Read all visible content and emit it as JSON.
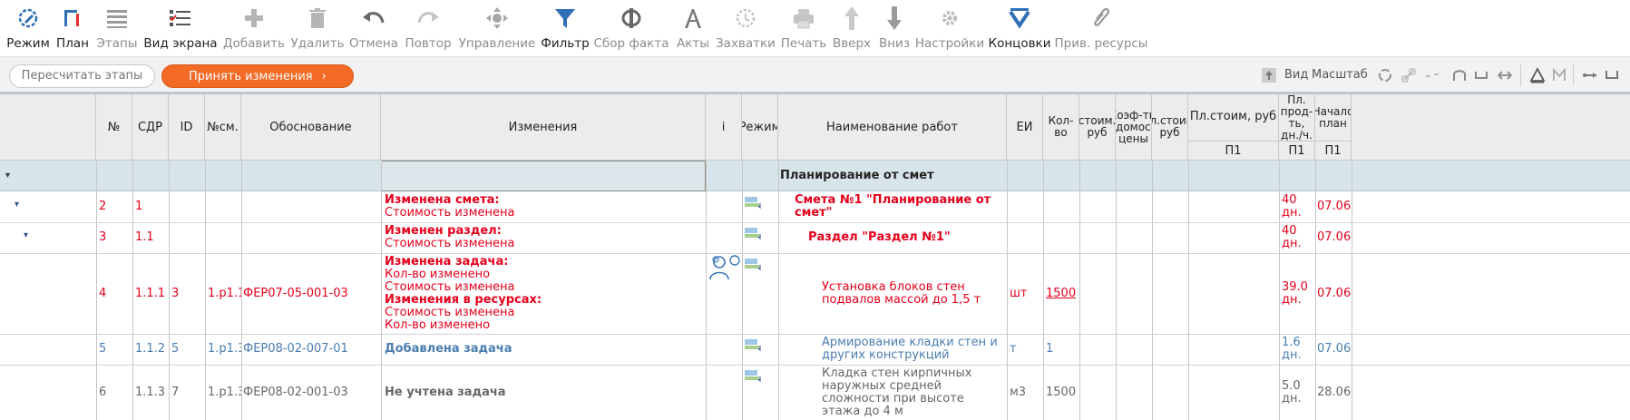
{
  "toolbar": {
    "items": [
      {
        "label": "Режим",
        "icon": "mode-icon",
        "enabled": true
      },
      {
        "label": "План",
        "icon": "plan-icon",
        "enabled": true
      },
      {
        "label": "Этапы",
        "icon": "stages-icon",
        "enabled": false
      },
      {
        "label": "Вид экрана",
        "icon": "screen-view-icon",
        "enabled": true
      },
      {
        "label": "Добавить",
        "icon": "add-icon",
        "enabled": false
      },
      {
        "label": "Удалить",
        "icon": "delete-icon",
        "enabled": false
      },
      {
        "label": "Отмена",
        "icon": "undo-icon",
        "enabled": false
      },
      {
        "label": "Повтор",
        "icon": "redo-icon",
        "enabled": false
      },
      {
        "label": "Управление",
        "icon": "control-icon",
        "enabled": false
      },
      {
        "label": "Фильтр",
        "icon": "filter-icon",
        "enabled": true
      },
      {
        "label": "Сбор факта",
        "icon": "fact-icon",
        "enabled": false
      },
      {
        "label": "Акты",
        "icon": "acts-icon",
        "enabled": false
      },
      {
        "label": "Захватки",
        "icon": "grips-icon",
        "enabled": false
      },
      {
        "label": "Печать",
        "icon": "print-icon",
        "enabled": false
      },
      {
        "label": "Вверх",
        "icon": "arrow-up-icon",
        "enabled": false
      },
      {
        "label": "Вниз",
        "icon": "arrow-down-icon",
        "enabled": false
      },
      {
        "label": "Настройки",
        "icon": "settings-icon",
        "enabled": false
      },
      {
        "label": "Концовки",
        "icon": "endings-icon",
        "enabled": true
      },
      {
        "label": "Прив. ресурсы",
        "icon": "attach-resources-icon",
        "enabled": false
      }
    ]
  },
  "actions": {
    "recalc_label": "Пересчитать этапы",
    "accept_label": "Принять изменения",
    "view_label": "Вид",
    "scale_label": "Масштаб"
  },
  "columns": {
    "num": "№",
    "sdr": "СДР",
    "id": "ID",
    "nsm": "№см.",
    "basis": "Обоснование",
    "changes": "Изменения",
    "info": "i",
    "mode": "Режим",
    "work_name": "Наименование работ",
    "unit": "ЕИ",
    "qty": "Кол-во",
    "unit_cost": "Пл.стоим.ЕИ, руб",
    "coef": "Коэф-ты ведомости цены",
    "cost_cut": "Пл.стоим. руб",
    "plan_cost": "Пл.стоим, руб",
    "plan_cost_sub": "П1",
    "duration": "Пл. прод-ть, дн./ч.",
    "duration_sub": "П1",
    "start": "Начало план",
    "start_sub": "П1"
  },
  "group": {
    "title": "Планирование от смет"
  },
  "rows": [
    {
      "num": "2",
      "sdr": "1",
      "id": "",
      "nsm": "",
      "basis": "",
      "change_title": "Изменена смета:",
      "change_lines": [
        "Стоимость изменена"
      ],
      "change_title2": "",
      "change_lines2": [],
      "work": "Смета №1 \"Планирование от смет\"",
      "unit": "",
      "qty": "",
      "duration": "40 дн.",
      "start": "07.06",
      "style": "red"
    },
    {
      "num": "3",
      "sdr": "1.1",
      "id": "",
      "nsm": "",
      "basis": "",
      "change_title": "Изменен раздел:",
      "change_lines": [
        "Стоимость изменена"
      ],
      "change_title2": "",
      "change_lines2": [],
      "work": "Раздел \"Раздел №1\"",
      "unit": "",
      "qty": "",
      "duration": "40 дн.",
      "start": "07.06",
      "style": "red"
    },
    {
      "num": "4",
      "sdr": "1.1.1",
      "id": "3",
      "nsm": "1.р1.1",
      "basis": "ФЕР07-05-001-03",
      "change_title": "Изменена задача:",
      "change_lines": [
        "Кол-во изменено",
        "Стоимость изменена"
      ],
      "change_title2": "Изменения в ресурсах:",
      "change_lines2": [
        "Стоимость изменена",
        "Кол-во изменено"
      ],
      "work": "Установка блоков стен подвалов массой до 1,5 т",
      "unit": "шт",
      "qty": "1500",
      "duration": "39.0 дн.",
      "start": "07.06",
      "style": "red"
    },
    {
      "num": "5",
      "sdr": "1.1.2",
      "id": "5",
      "nsm": "1.р1.3",
      "basis": "ФЕР08-02-007-01",
      "change_title": "Добавлена задача",
      "change_lines": [],
      "change_title2": "",
      "change_lines2": [],
      "work": "Армирование кладки стен и других конструкций",
      "unit": "т",
      "qty": "1",
      "duration": "1.6 дн.",
      "start": "07.06",
      "style": "blue"
    },
    {
      "num": "6",
      "sdr": "1.1.3",
      "id": "7",
      "nsm": "1.р1.3",
      "basis": "ФЕР08-02-001-03",
      "change_title": "Не учтена задача",
      "change_lines": [],
      "change_title2": "",
      "change_lines2": [],
      "work": "Кладка стен кирпичных наружных средней сложности при высоте этажа до 4 м",
      "unit": "м3",
      "qty": "1500",
      "duration": "5.0 дн.",
      "start": "28.06",
      "style": "gray"
    }
  ]
}
